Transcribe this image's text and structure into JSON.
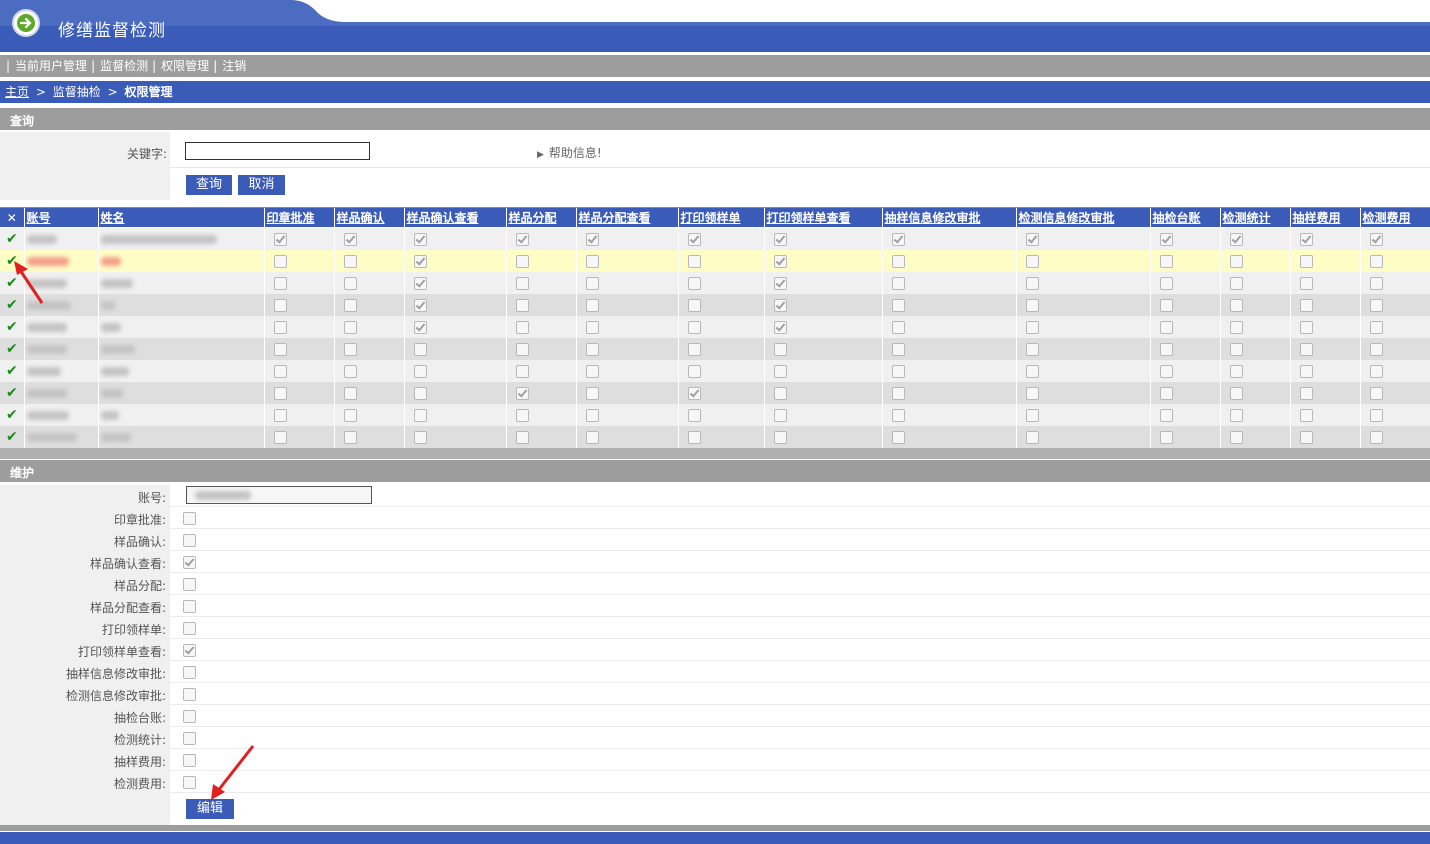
{
  "app": {
    "title": "修缮监督检测"
  },
  "menu": [
    "当前用户管理",
    "监督检测",
    "权限管理",
    "注销"
  ],
  "breadcrumb": {
    "home": "主页",
    "sep": ">",
    "level2": "监督抽检",
    "current": "权限管理"
  },
  "query": {
    "section_title": "查询",
    "keyword_label": "关键字:",
    "keyword_value": "",
    "help_text": "帮助信息!",
    "search_button": "查询",
    "cancel_button": "取消"
  },
  "grid": {
    "close_symbol": "✕",
    "columns": [
      "账号",
      "姓名",
      "印章批准",
      "样品确认",
      "样品确认查看",
      "样品分配",
      "样品分配查看",
      "打印领样单",
      "打印领样单查看",
      "抽样信息修改审批",
      "检测信息修改审批",
      "抽检台账",
      "检测统计",
      "抽样费用",
      "检测费用"
    ],
    "selected_row": 1,
    "rows": [
      {
        "perms": [
          1,
          1,
          1,
          1,
          1,
          1,
          1,
          1,
          1,
          1,
          1,
          1,
          1
        ]
      },
      {
        "perms": [
          0,
          0,
          1,
          0,
          0,
          0,
          1,
          0,
          0,
          0,
          0,
          0,
          0
        ]
      },
      {
        "perms": [
          0,
          0,
          1,
          0,
          0,
          0,
          1,
          0,
          0,
          0,
          0,
          0,
          0
        ]
      },
      {
        "perms": [
          0,
          0,
          1,
          0,
          0,
          0,
          1,
          0,
          0,
          0,
          0,
          0,
          0
        ]
      },
      {
        "perms": [
          0,
          0,
          1,
          0,
          0,
          0,
          1,
          0,
          0,
          0,
          0,
          0,
          0
        ]
      },
      {
        "perms": [
          0,
          0,
          0,
          0,
          0,
          0,
          0,
          0,
          0,
          0,
          0,
          0,
          0
        ]
      },
      {
        "perms": [
          0,
          0,
          0,
          0,
          0,
          0,
          0,
          0,
          0,
          0,
          0,
          0,
          0
        ]
      },
      {
        "perms": [
          0,
          0,
          0,
          1,
          0,
          1,
          0,
          0,
          0,
          0,
          0,
          0,
          0
        ]
      },
      {
        "perms": [
          0,
          0,
          0,
          0,
          0,
          0,
          0,
          0,
          0,
          0,
          0,
          0,
          0
        ]
      },
      {
        "perms": [
          0,
          0,
          0,
          0,
          0,
          0,
          0,
          0,
          0,
          0,
          0,
          0,
          0
        ]
      }
    ]
  },
  "maintenance": {
    "section_title": "维护",
    "account_label": "账号:",
    "fields": [
      {
        "label": "印章批准:",
        "checked": false
      },
      {
        "label": "样品确认:",
        "checked": false
      },
      {
        "label": "样品确认查看:",
        "checked": true
      },
      {
        "label": "样品分配:",
        "checked": false
      },
      {
        "label": "样品分配查看:",
        "checked": false
      },
      {
        "label": "打印领样单:",
        "checked": false
      },
      {
        "label": "打印领样单查看:",
        "checked": true
      },
      {
        "label": "抽样信息修改审批:",
        "checked": false
      },
      {
        "label": "检测信息修改审批:",
        "checked": false
      },
      {
        "label": "抽检台账:",
        "checked": false
      },
      {
        "label": "检测统计:",
        "checked": false
      },
      {
        "label": "抽样费用:",
        "checked": false
      },
      {
        "label": "检测费用:",
        "checked": false
      }
    ],
    "edit_button": "编辑"
  },
  "colors": {
    "primary": "#3a5cb8",
    "bar_gray": "#9d9d9d",
    "selected_row": "#fefdc6",
    "annotation_arrow": "#e02020"
  }
}
